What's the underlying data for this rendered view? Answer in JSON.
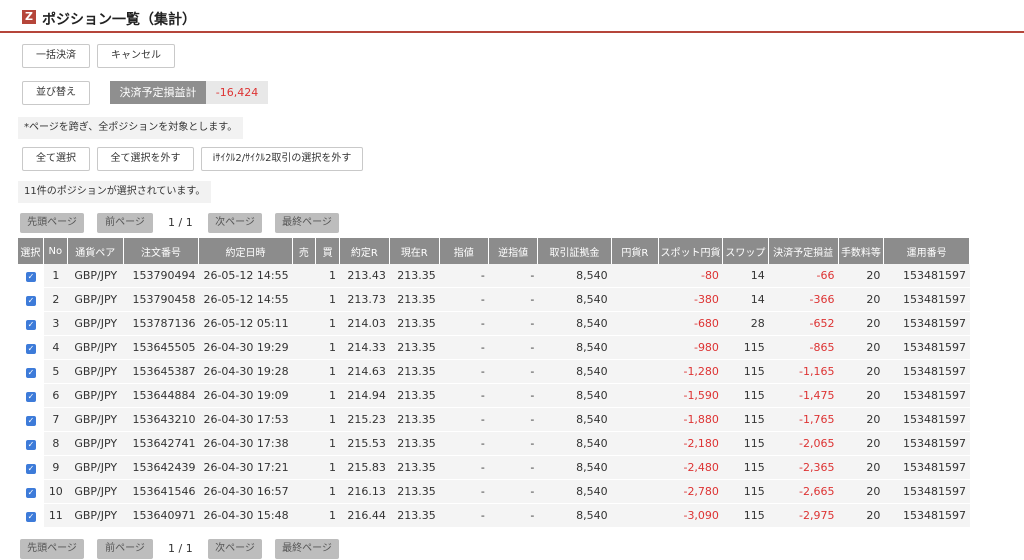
{
  "header": {
    "logo": "Z",
    "title": "ポジション一覧（集計）"
  },
  "buttons": {
    "bulk_settle": "一括決済",
    "cancel": "キャンセル",
    "sort": "並び替え",
    "select_all": "全て選択",
    "deselect_all": "全て選択を外す",
    "deselect_cycle": "iｻｲｸﾙ2/ｻｲｸﾙ2取引の選択を外す"
  },
  "summary": {
    "label": "決済予定損益計",
    "value": "-16,424"
  },
  "notes": {
    "cross_page": "*ページを跨ぎ、全ポジションを対象とします。",
    "selected_count": "11件のポジションが選択されています。"
  },
  "pagination": {
    "first": "先頭ページ",
    "prev": "前ページ",
    "page": "1 / 1",
    "next": "次ページ",
    "last": "最終ページ"
  },
  "table": {
    "headers": [
      "選択",
      "No",
      "通貨ペア",
      "注文番号",
      "約定日時",
      "売",
      "買",
      "約定R",
      "現在R",
      "指値",
      "逆指値",
      "取引証拠金",
      "円貨R",
      "スポット円貨",
      "スワップ",
      "決済予定損益",
      "手数料等",
      "運用番号"
    ],
    "rows": [
      {
        "no": "1",
        "pair": "GBP/JPY",
        "order": "153790494",
        "date": "26-05-12 14:55",
        "sell": "",
        "buy": "1",
        "rate": "213.43",
        "cur": "213.35",
        "limit": "-",
        "stop": "-",
        "margin": "8,540",
        "yen": "",
        "spot": "-80",
        "swap": "14",
        "pl": "-66",
        "fee": "20",
        "acct": "153481597"
      },
      {
        "no": "2",
        "pair": "GBP/JPY",
        "order": "153790458",
        "date": "26-05-12 14:55",
        "sell": "",
        "buy": "1",
        "rate": "213.73",
        "cur": "213.35",
        "limit": "-",
        "stop": "-",
        "margin": "8,540",
        "yen": "",
        "spot": "-380",
        "swap": "14",
        "pl": "-366",
        "fee": "20",
        "acct": "153481597"
      },
      {
        "no": "3",
        "pair": "GBP/JPY",
        "order": "153787136",
        "date": "26-05-12 05:11",
        "sell": "",
        "buy": "1",
        "rate": "214.03",
        "cur": "213.35",
        "limit": "-",
        "stop": "-",
        "margin": "8,540",
        "yen": "",
        "spot": "-680",
        "swap": "28",
        "pl": "-652",
        "fee": "20",
        "acct": "153481597"
      },
      {
        "no": "4",
        "pair": "GBP/JPY",
        "order": "153645505",
        "date": "26-04-30 19:29",
        "sell": "",
        "buy": "1",
        "rate": "214.33",
        "cur": "213.35",
        "limit": "-",
        "stop": "-",
        "margin": "8,540",
        "yen": "",
        "spot": "-980",
        "swap": "115",
        "pl": "-865",
        "fee": "20",
        "acct": "153481597"
      },
      {
        "no": "5",
        "pair": "GBP/JPY",
        "order": "153645387",
        "date": "26-04-30 19:28",
        "sell": "",
        "buy": "1",
        "rate": "214.63",
        "cur": "213.35",
        "limit": "-",
        "stop": "-",
        "margin": "8,540",
        "yen": "",
        "spot": "-1,280",
        "swap": "115",
        "pl": "-1,165",
        "fee": "20",
        "acct": "153481597"
      },
      {
        "no": "6",
        "pair": "GBP/JPY",
        "order": "153644884",
        "date": "26-04-30 19:09",
        "sell": "",
        "buy": "1",
        "rate": "214.94",
        "cur": "213.35",
        "limit": "-",
        "stop": "-",
        "margin": "8,540",
        "yen": "",
        "spot": "-1,590",
        "swap": "115",
        "pl": "-1,475",
        "fee": "20",
        "acct": "153481597"
      },
      {
        "no": "7",
        "pair": "GBP/JPY",
        "order": "153643210",
        "date": "26-04-30 17:53",
        "sell": "",
        "buy": "1",
        "rate": "215.23",
        "cur": "213.35",
        "limit": "-",
        "stop": "-",
        "margin": "8,540",
        "yen": "",
        "spot": "-1,880",
        "swap": "115",
        "pl": "-1,765",
        "fee": "20",
        "acct": "153481597"
      },
      {
        "no": "8",
        "pair": "GBP/JPY",
        "order": "153642741",
        "date": "26-04-30 17:38",
        "sell": "",
        "buy": "1",
        "rate": "215.53",
        "cur": "213.35",
        "limit": "-",
        "stop": "-",
        "margin": "8,540",
        "yen": "",
        "spot": "-2,180",
        "swap": "115",
        "pl": "-2,065",
        "fee": "20",
        "acct": "153481597"
      },
      {
        "no": "9",
        "pair": "GBP/JPY",
        "order": "153642439",
        "date": "26-04-30 17:21",
        "sell": "",
        "buy": "1",
        "rate": "215.83",
        "cur": "213.35",
        "limit": "-",
        "stop": "-",
        "margin": "8,540",
        "yen": "",
        "spot": "-2,480",
        "swap": "115",
        "pl": "-2,365",
        "fee": "20",
        "acct": "153481597"
      },
      {
        "no": "10",
        "pair": "GBP/JPY",
        "order": "153641546",
        "date": "26-04-30 16:57",
        "sell": "",
        "buy": "1",
        "rate": "216.13",
        "cur": "213.35",
        "limit": "-",
        "stop": "-",
        "margin": "8,540",
        "yen": "",
        "spot": "-2,780",
        "swap": "115",
        "pl": "-2,665",
        "fee": "20",
        "acct": "153481597"
      },
      {
        "no": "11",
        "pair": "GBP/JPY",
        "order": "153640971",
        "date": "26-04-30 15:48",
        "sell": "",
        "buy": "1",
        "rate": "216.44",
        "cur": "213.35",
        "limit": "-",
        "stop": "-",
        "margin": "8,540",
        "yen": "",
        "spot": "-3,090",
        "swap": "115",
        "pl": "-2,975",
        "fee": "20",
        "acct": "153481597"
      }
    ]
  },
  "colors": {
    "accent": "#b5453a",
    "negative": "#dd3333",
    "checkbox": "#3d7bd9"
  }
}
